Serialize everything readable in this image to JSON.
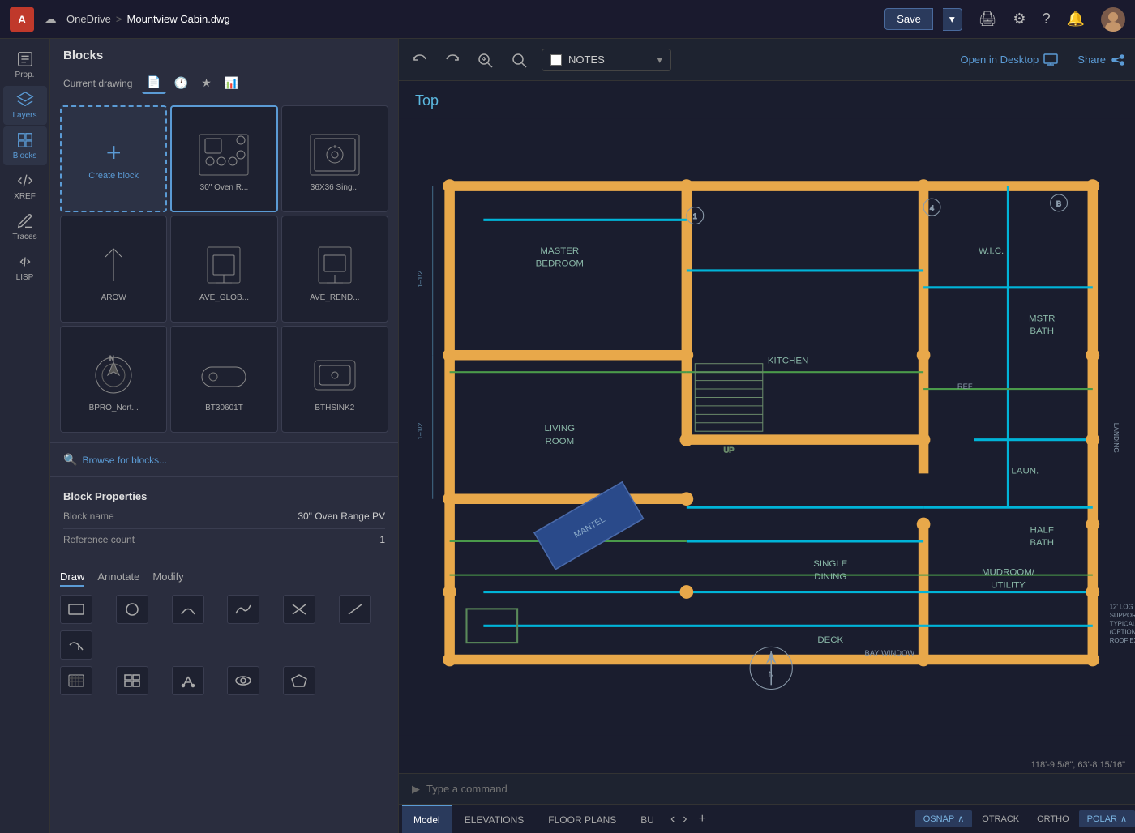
{
  "titlebar": {
    "app_letter": "A",
    "cloud_icon": "☁",
    "breadcrumb_cloud": "OneDrive",
    "breadcrumb_sep": ">",
    "filename": "Mountview Cabin.dwg",
    "save_label": "Save",
    "save_dropdown_icon": "▾"
  },
  "sidebar": {
    "items": [
      {
        "id": "prop",
        "label": "Prop.",
        "icon_unicode": "📋"
      },
      {
        "id": "layers",
        "label": "Layers",
        "icon_unicode": "▤"
      },
      {
        "id": "blocks",
        "label": "Blocks",
        "icon_unicode": "⊞",
        "active": true
      },
      {
        "id": "xref",
        "label": "XREF",
        "icon_unicode": "⇄"
      },
      {
        "id": "traces",
        "label": "Traces",
        "icon_unicode": "🖊"
      },
      {
        "id": "lisp",
        "label": "LISP",
        "icon_unicode": "f(x)"
      }
    ]
  },
  "blocks_panel": {
    "title": "Blocks",
    "current_drawing_label": "Current drawing",
    "tab_icons": [
      "file",
      "clock",
      "star",
      "chart"
    ],
    "create_block_label": "Create block",
    "blocks": [
      {
        "id": "create",
        "label": "Create block",
        "type": "create"
      },
      {
        "id": "oven30",
        "label": "30\" Oven R...",
        "type": "block"
      },
      {
        "id": "sink36",
        "label": "36X36 Sing...",
        "type": "block"
      },
      {
        "id": "arow",
        "label": "AROW",
        "type": "block"
      },
      {
        "id": "ave_glob",
        "label": "AVE_GLOB...",
        "type": "block"
      },
      {
        "id": "ave_rend",
        "label": "AVE_REND...",
        "type": "block"
      },
      {
        "id": "bpro_nort",
        "label": "BPRO_Nort...",
        "type": "block"
      },
      {
        "id": "bt30601t",
        "label": "BT30601T",
        "type": "block"
      },
      {
        "id": "bthsink2",
        "label": "BTHSINK2",
        "type": "block"
      }
    ],
    "browse_label": "Browse for blocks...",
    "properties_title": "Block Properties",
    "block_name_label": "Block name",
    "block_name_value": "30\" Oven Range PV",
    "ref_count_label": "Reference count",
    "ref_count_value": "1"
  },
  "draw_toolbar": {
    "tabs": [
      "Draw",
      "Annotate",
      "Modify"
    ],
    "active_tab": "Draw",
    "tools_row1": [
      "▭",
      "○",
      "⌒",
      "∿",
      "↗",
      "⟋",
      "↩"
    ],
    "tools_row2": [
      "▦",
      "⊞",
      "✳",
      "◎",
      "⬠"
    ]
  },
  "canvas": {
    "view_label": "Top",
    "notes_label": "NOTES",
    "open_desktop_label": "Open in Desktop",
    "share_label": "Share",
    "coords": "118'-9 5/8\", 63'-8 15/16\""
  },
  "command": {
    "prompt": "▶",
    "placeholder": "Type a command"
  },
  "status_bar": {
    "tabs": [
      {
        "id": "model",
        "label": "Model",
        "active": true
      },
      {
        "id": "elevations",
        "label": "ELEVATIONS"
      },
      {
        "id": "floor_plans",
        "label": "FLOOR PLANS"
      },
      {
        "id": "bu",
        "label": "BU"
      }
    ],
    "toggles": [
      {
        "id": "osnap",
        "label": "OSNAP",
        "active": true,
        "has_arrow": true
      },
      {
        "id": "otrack",
        "label": "OTRACK",
        "active": false
      },
      {
        "id": "ortho",
        "label": "ORTHO",
        "active": false
      },
      {
        "id": "polar",
        "label": "POLAR",
        "active": true,
        "has_arrow": true
      }
    ]
  }
}
